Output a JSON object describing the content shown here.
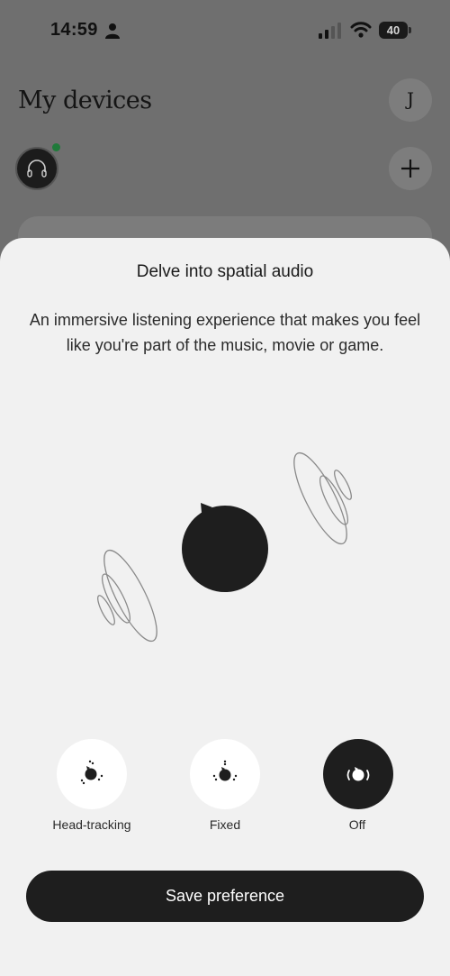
{
  "status_bar": {
    "time": "14:59",
    "battery": "40",
    "icons": [
      "person-icon",
      "signal-icon",
      "wifi-icon",
      "battery-icon"
    ]
  },
  "background_screen": {
    "title": "My devices",
    "profile_initial": "J",
    "icons": [
      "headphones-icon",
      "plus-icon"
    ],
    "colors": {
      "online_dot": "#1f7a3a"
    }
  },
  "sheet": {
    "title": "Delve into spatial audio",
    "description": "An immersive listening experience that makes you feel like you're part of the music, movie or game.",
    "illustration_icon": "spatial-audio-head-icon",
    "modes": [
      {
        "label": "Head-tracking",
        "icon": "head-tracking-icon",
        "selected": false
      },
      {
        "label": "Fixed",
        "icon": "fixed-icon",
        "selected": false
      },
      {
        "label": "Off",
        "icon": "spatial-off-icon",
        "selected": true
      }
    ],
    "save_label": "Save preference"
  },
  "colors": {
    "overlay": "#6f6f6f",
    "sheet_bg": "#f1f1f1",
    "primary_dark": "#1e1e1e",
    "mode_bg": "#ffffff"
  }
}
